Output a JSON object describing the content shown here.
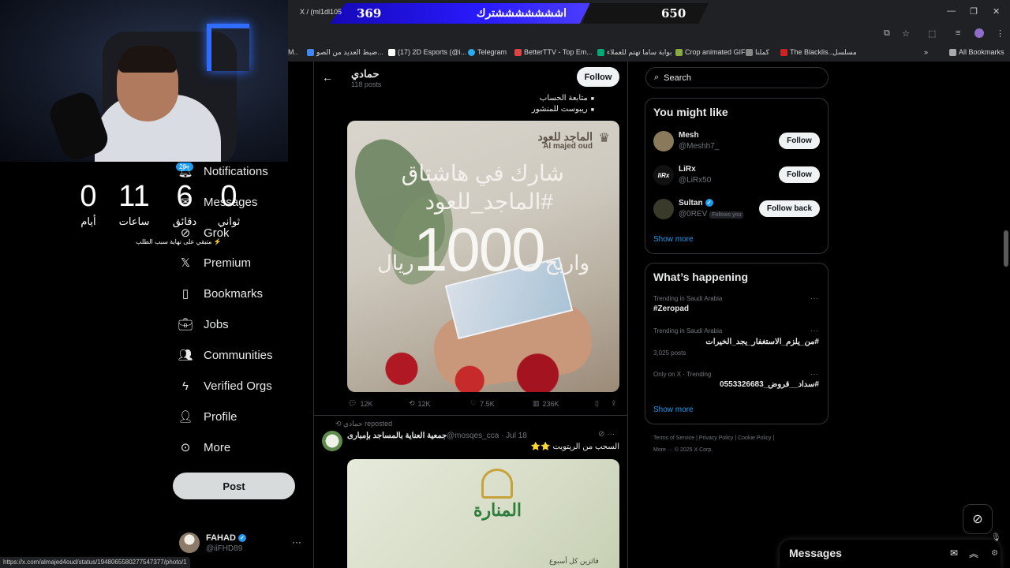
{
  "overlay": {
    "banner_small": "X / (ml1dl105",
    "left_count": "369",
    "title": "اشششششششترك",
    "right_count": "650",
    "countdown": [
      {
        "value": "0",
        "label": "أيام"
      },
      {
        "value": "11",
        "label": "ساعات"
      },
      {
        "value": "6",
        "label": "دقائق"
      },
      {
        "value": "0",
        "label": "ثواني"
      }
    ],
    "countdown_caption": "متبقي على نهاية سبب الطلب ⚡"
  },
  "bookmarks": [
    {
      "label": "ضبط العديد من الصو...",
      "color": "#4285f4"
    },
    {
      "label": "(17) 2D Esports (@i...",
      "color": "#ffffff"
    },
    {
      "label": "Telegram",
      "color": "#2aabee"
    },
    {
      "label": "BetterTTV - Top Em...",
      "color": "#d44"
    },
    {
      "label": "بوابة ساما تهتم للعملاء",
      "color": "#0a7"
    },
    {
      "label": "Crop animated GIF",
      "color": "#8a4"
    },
    {
      "label": "كملنا",
      "color": "#888"
    },
    {
      "label": "The Blacklis...",
      "color": "#c22"
    },
    {
      "label": "مسلسل",
      "color": "#c22"
    },
    {
      "label": "All Bookmarks",
      "color": "#aaa"
    }
  ],
  "nav": {
    "notifications_badge": "20+",
    "items": [
      {
        "label": "Notifications",
        "icon": "bell-icon"
      },
      {
        "label": "Messages",
        "icon": "mail-icon"
      },
      {
        "label": "Grok",
        "icon": "grok-icon"
      },
      {
        "label": "Premium",
        "icon": "x-logo-icon"
      },
      {
        "label": "Bookmarks",
        "icon": "bookmark-icon"
      },
      {
        "label": "Jobs",
        "icon": "briefcase-icon"
      },
      {
        "label": "Communities",
        "icon": "people-icon"
      },
      {
        "label": "Verified Orgs",
        "icon": "lightning-icon"
      },
      {
        "label": "Profile",
        "icon": "person-icon"
      },
      {
        "label": "More",
        "icon": "more-circle-icon"
      }
    ],
    "post_label": "Post",
    "me_name": "FAHAD",
    "me_handle": "@iiFHD89"
  },
  "status_url": "https://x.com/almajed4oud/status/1948065580277547377/photo/1",
  "profile": {
    "name": "حمادي",
    "posts": "118 posts",
    "follow_label": "Follow"
  },
  "tweet1": {
    "bullets": [
      "متابعة الحساب",
      "ريبوست للمنشور"
    ],
    "image": {
      "brand_ar": "الماجد للعود",
      "brand_en": "Al majed oud",
      "line1": "شارك في هاشتاق",
      "line2": "#الماجد_للعود",
      "amount": "1000",
      "win": "واربح",
      "riyal": "ريال"
    },
    "actions": {
      "replies": "12K",
      "reposts": "12K",
      "likes": "7.5K",
      "views": "236K"
    }
  },
  "tweet2": {
    "repost_by": "حمادي reposted",
    "name": "جمعية العناية بالمساجد بإمبارى",
    "handle": "@mosqes_cca · Jul 18",
    "text": "السحب من الريتويت ⭐⭐",
    "logo_text": "المنارة",
    "image_bottom": "فائزين كل أسبوع"
  },
  "right": {
    "search_placeholder": "Search",
    "like_title": "You might like",
    "users": [
      {
        "name": "Mesh",
        "handle": "@Meshh7_",
        "button": "Follow",
        "avatar_color": "#8a7a5c",
        "verified": false,
        "follows_you": ""
      },
      {
        "name": "LiRx",
        "handle": "@LiRx50",
        "button": "Follow",
        "avatar_color": "#111111",
        "verified": false,
        "follows_you": ""
      },
      {
        "name": "Sultan",
        "handle": "@0REV",
        "button": "Follow back",
        "avatar_color": "#3a3a2a",
        "verified": true,
        "follows_you": "Follows you"
      }
    ],
    "show_more": "Show more",
    "happening_title": "What’s happening",
    "trends": [
      {
        "meta": "Trending in Saudi Arabia",
        "title": "#Zeropad",
        "posts": ""
      },
      {
        "meta": "Trending in Saudi Arabia",
        "title": "#من_يلزم_الاستغفار_يجد_الخيرات",
        "posts": "3,025 posts"
      },
      {
        "meta": "Only on X · Trending",
        "title": "#سداد__قروض_0553326683",
        "posts": ""
      }
    ],
    "footer1": "Terms of Service  |  Privacy Policy  |  Cookie Policy  |",
    "footer2": "More ···  © 2025 X Corp."
  },
  "messages": {
    "title": "Messages"
  }
}
